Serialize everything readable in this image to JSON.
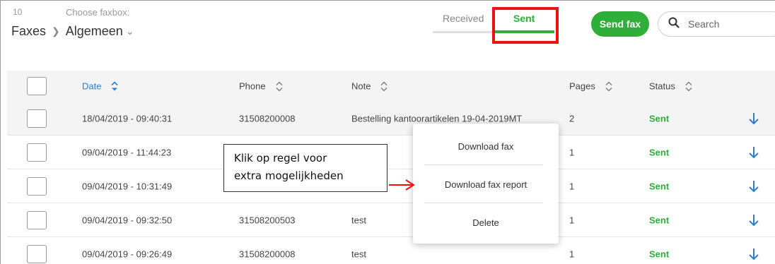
{
  "header": {
    "count": "10",
    "faxbox_label": "Choose faxbox:",
    "breadcrumb_root": "Faxes",
    "breadcrumb_current": "Algemeen"
  },
  "tabs": {
    "received": "Received",
    "sent": "Sent"
  },
  "send_button": "Send fax",
  "search": {
    "placeholder": "Search"
  },
  "table": {
    "headers": {
      "date": "Date",
      "phone": "Phone",
      "note": "Note",
      "pages": "Pages",
      "status": "Status"
    },
    "rows": [
      {
        "date": "18/04/2019 - 09:40:31",
        "phone": "31508200008",
        "note": "Bestelling kantoorartikelen 19-04-2019MT",
        "pages": "2",
        "status": "Sent"
      },
      {
        "date": "09/04/2019 - 11:44:23",
        "phone": "",
        "note": "",
        "pages": "1",
        "status": "Sent"
      },
      {
        "date": "09/04/2019 - 10:31:49",
        "phone": "",
        "note": "",
        "pages": "1",
        "status": "Sent"
      },
      {
        "date": "09/04/2019 - 09:32:50",
        "phone": "31508200503",
        "note": "test",
        "pages": "1",
        "status": "Sent"
      },
      {
        "date": "09/04/2019 - 09:26:49",
        "phone": "31508200008",
        "note": "test",
        "pages": "1",
        "status": "Sent"
      }
    ]
  },
  "context_menu": {
    "download_fax": "Download fax",
    "download_report": "Download fax report",
    "delete": "Delete"
  },
  "callout": {
    "line1": "Klik op regel voor",
    "line2": "extra mogelijkheden"
  },
  "colors": {
    "accent_green": "#2fae3a",
    "sort_blue": "#2a7fd4",
    "highlight_red": "#ee1111"
  }
}
